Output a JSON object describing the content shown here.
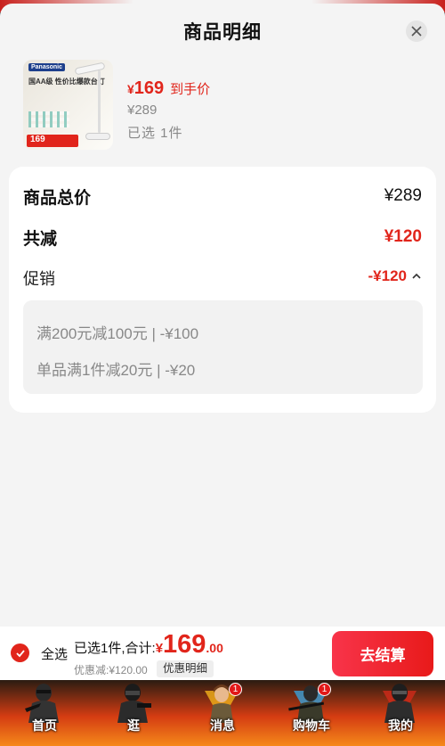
{
  "sheet": {
    "title": "商品明细",
    "close_icon": "close-icon"
  },
  "product": {
    "thumb": {
      "brand": "Panasonic",
      "headline": "国AA级 性价比爆款台灯",
      "price_tag": "169"
    },
    "price_currency": "¥",
    "price": "169",
    "price_label": "到手价",
    "original_price": "¥289",
    "selected_qty": "已选 1件"
  },
  "summary": {
    "total_label": "商品总价",
    "total_value": "¥289",
    "reduce_label": "共减",
    "reduce_value": "¥120",
    "promo_label": "促销",
    "promo_value": "-¥120",
    "promo_items": [
      "满200元减100元 | -¥100",
      "单品满1件减20元 | -¥20"
    ]
  },
  "action_bar": {
    "select_all": "全选",
    "selected_text": "已选1件,合计:",
    "currency": "¥",
    "total_int": "169",
    "total_dec": ".00",
    "discount_text": "优惠减:¥120.00",
    "detail_button": "优惠明细",
    "checkout_button": "去结算"
  },
  "tabbar": {
    "tabs": [
      {
        "label": "首页",
        "badge": ""
      },
      {
        "label": "逛",
        "badge": ""
      },
      {
        "label": "消息",
        "badge": "1"
      },
      {
        "label": "购物车",
        "badge": "1"
      },
      {
        "label": "我的",
        "badge": ""
      }
    ]
  },
  "colors": {
    "accent": "#e1251b",
    "sheet_bg": "#f4f4f4"
  }
}
